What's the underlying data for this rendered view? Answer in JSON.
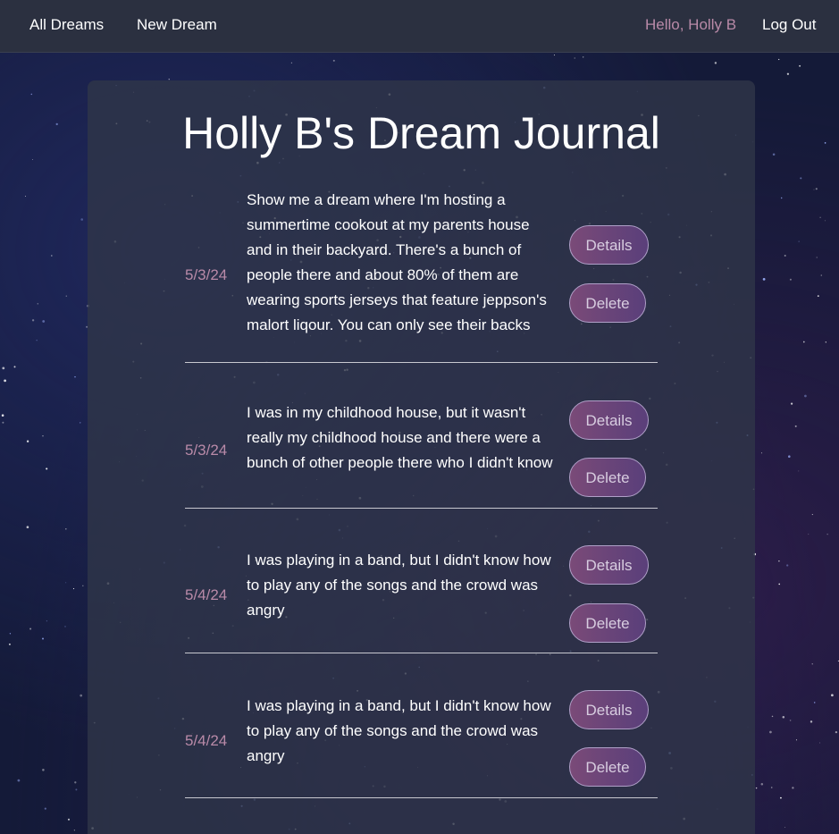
{
  "nav": {
    "all_dreams": "All Dreams",
    "new_dream": "New Dream",
    "greeting": "Hello, Holly B",
    "log_out": "Log Out"
  },
  "page": {
    "title": "Holly B's Dream Journal"
  },
  "dreams": [
    {
      "date": "5/3/24",
      "text": "Show me a dream where I'm hosting a summertime cookout at my parents house and in their backyard. There's a bunch of people there and about 80% of them are wearing sports jerseys that feature jeppson's malort liqour. You can only see their backs",
      "details_label": "Details",
      "delete_label": "Delete"
    },
    {
      "date": "5/3/24",
      "text": "I was in my childhood house, but it wasn't really my childhood house and there were a bunch of other people there who I didn't know",
      "details_label": "Details",
      "delete_label": "Delete"
    },
    {
      "date": "5/4/24",
      "text": "I was playing in a band, but I didn't know how to play any of the songs and the crowd was angry",
      "details_label": "Details",
      "delete_label": "Delete"
    },
    {
      "date": "5/4/24",
      "text": "I was playing in a band, but I didn't know how to play any of the songs and the crowd was angry",
      "details_label": "Details",
      "delete_label": "Delete"
    }
  ],
  "colors": {
    "nav_bg": "#2b3040",
    "accent_pink": "#b98aa8",
    "button_gradient_start": "#7a4a78",
    "button_gradient_end": "#5a3f7a"
  }
}
